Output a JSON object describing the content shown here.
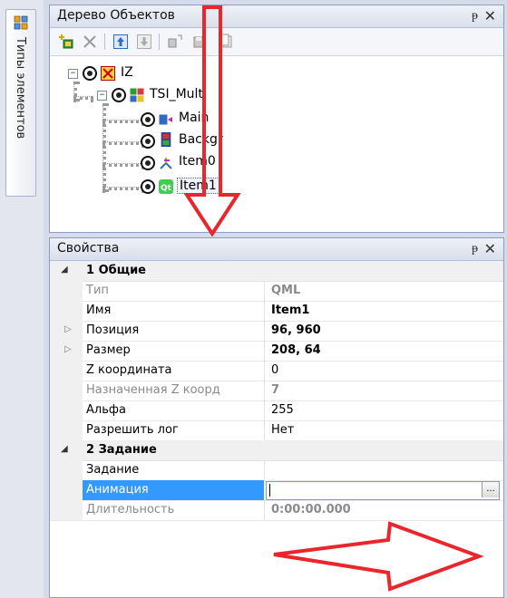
{
  "left_strip": {
    "tab_label": "Типы элементов"
  },
  "tree_panel": {
    "title": "Дерево Объектов",
    "pin_glyph": "ᵽ",
    "close_glyph": "✕",
    "toolbar": [
      "add-element",
      "delete",
      "move-up",
      "move-down",
      "import",
      "export",
      "copy"
    ],
    "nodes": [
      {
        "label": "IZ",
        "level": 0
      },
      {
        "label": "TSI_Multi",
        "level": 1
      },
      {
        "label": "Main",
        "level": 2
      },
      {
        "label": "Backgr",
        "level": 2
      },
      {
        "label": "Item0",
        "level": 2
      },
      {
        "label": "Item1",
        "level": 2
      }
    ]
  },
  "props_panel": {
    "title": "Свойства",
    "pin_glyph": "ᵽ",
    "close_glyph": "✕",
    "categories": [
      {
        "name": "1 Общие",
        "rows": [
          {
            "name": "Тип",
            "value": "QML",
            "disabled": true,
            "bold": true
          },
          {
            "name": "Имя",
            "value": "Item1",
            "bold": true
          },
          {
            "name": "Позиция",
            "value": "96, 960",
            "bold": true,
            "expandable": true
          },
          {
            "name": "Размер",
            "value": "208, 64",
            "bold": true,
            "expandable": true
          },
          {
            "name": "Z координата",
            "value": "0"
          },
          {
            "name": "Назначенная Z коорд",
            "value": "7",
            "disabled": true,
            "bold": true
          },
          {
            "name": "Альфа",
            "value": "255"
          },
          {
            "name": "Разрешить лог",
            "value": "Нет"
          }
        ]
      },
      {
        "name": "2 Задание",
        "rows": [
          {
            "name": "Задание",
            "value": ""
          },
          {
            "name": "Анимация",
            "value": "",
            "selected": true
          },
          {
            "name": "Длительность",
            "value": "0:00:00.000",
            "disabled": true,
            "bold": true
          }
        ]
      }
    ],
    "ellipsis": "..."
  },
  "colors": {
    "accent": "#3399ff",
    "annotation": "#e8262b"
  }
}
